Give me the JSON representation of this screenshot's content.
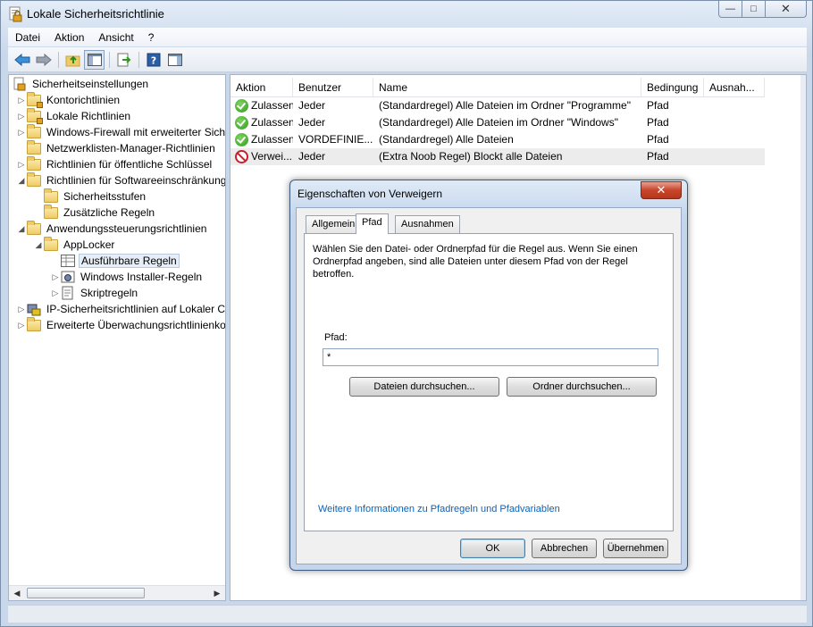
{
  "window": {
    "title": "Lokale Sicherheitsrichtlinie",
    "caption": {
      "minimize": "—",
      "maximize": "□",
      "close": "✕"
    }
  },
  "menu": [
    "Datei",
    "Aktion",
    "Ansicht",
    "?"
  ],
  "toolbar": {
    "icons": [
      "back-arrow-icon",
      "forward-arrow-icon",
      "up-folder-icon",
      "show-hide-tree-icon",
      "export-list-icon",
      "help-icon",
      "properties-pane-icon"
    ]
  },
  "tree": {
    "root": "Sicherheitseinstellungen",
    "items": [
      {
        "label": "Kontorichtlinien"
      },
      {
        "label": "Lokale Richtlinien"
      },
      {
        "label": "Windows-Firewall mit erweiterter Sich"
      },
      {
        "label": "Netzwerklisten-Manager-Richtlinien"
      },
      {
        "label": "Richtlinien für öffentliche Schlüssel"
      },
      {
        "label": "Richtlinien für Softwareeinschränkung"
      },
      {
        "label": "Sicherheitsstufen"
      },
      {
        "label": "Zusätzliche Regeln"
      },
      {
        "label": "Anwendungssteuerungsrichtlinien"
      },
      {
        "label": "AppLocker"
      },
      {
        "label": "Ausführbare Regeln"
      },
      {
        "label": "Windows Installer-Regeln"
      },
      {
        "label": "Skriptregeln"
      },
      {
        "label": "IP-Sicherheitsrichtlinien auf Lokaler C"
      },
      {
        "label": "Erweiterte Überwachungsrichtlinienko"
      }
    ]
  },
  "list": {
    "columns": [
      "Aktion",
      "Benutzer",
      "Name",
      "Bedingung",
      "Ausnah..."
    ],
    "rows": [
      {
        "action": "Zulassen",
        "user": "Jeder",
        "name": "(Standardregel) Alle Dateien im Ordner \"Programme\"",
        "condition": "Pfad",
        "exceptions": ""
      },
      {
        "action": "Zulassen",
        "user": "Jeder",
        "name": "(Standardregel) Alle Dateien im Ordner \"Windows\"",
        "condition": "Pfad",
        "exceptions": ""
      },
      {
        "action": "Zulassen",
        "user": "VORDEFINIE...",
        "name": "(Standardregel) Alle Dateien",
        "condition": "Pfad",
        "exceptions": ""
      },
      {
        "action": "Verwei...",
        "user": "Jeder",
        "name": "(Extra Noob Regel) Blockt alle Dateien",
        "condition": "Pfad",
        "exceptions": ""
      }
    ]
  },
  "dialog": {
    "title": "Eigenschaften von Verweigern",
    "close": "✕",
    "tabs": [
      "Allgemein",
      "Pfad",
      "Ausnahmen"
    ],
    "description": "Wählen Sie den Datei- oder Ordnerpfad für die Regel aus. Wenn Sie einen Ordnerpfad angeben, sind alle Dateien unter diesem Pfad von der Regel betroffen.",
    "path_label": "Pfad:",
    "path_value": "*",
    "browse_files": "Dateien durchsuchen...",
    "browse_folders": "Ordner durchsuchen...",
    "info_link": "Weitere Informationen zu Pfadregeln und Pfadvariablen",
    "ok": "OK",
    "cancel": "Abbrechen",
    "apply": "Übernehmen"
  },
  "colors": {
    "link": "#0a62b9",
    "allow": "#2f9a1e",
    "deny": "#c8202a"
  }
}
